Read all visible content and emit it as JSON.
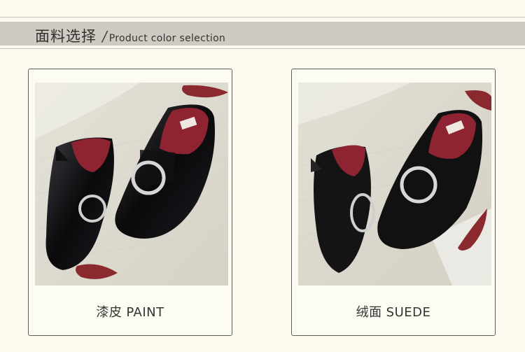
{
  "header": {
    "title_cn": "面料选择",
    "separator": "/",
    "title_en": "Product color selection"
  },
  "products": [
    {
      "name_cn": "漆皮",
      "name_en": "PAINT",
      "material": "patent-leather",
      "shoe_color": "#0b0b0d",
      "lining_color": "#8e2432"
    },
    {
      "name_cn": "绒面",
      "name_en": "SUEDE",
      "material": "suede",
      "shoe_color": "#151515",
      "lining_color": "#8e2432"
    }
  ],
  "colors": {
    "background": "#fcfaee",
    "header_band": "#cdcbc2",
    "card_border": "#5e5e5e",
    "leaf": "#8a2a2f"
  }
}
